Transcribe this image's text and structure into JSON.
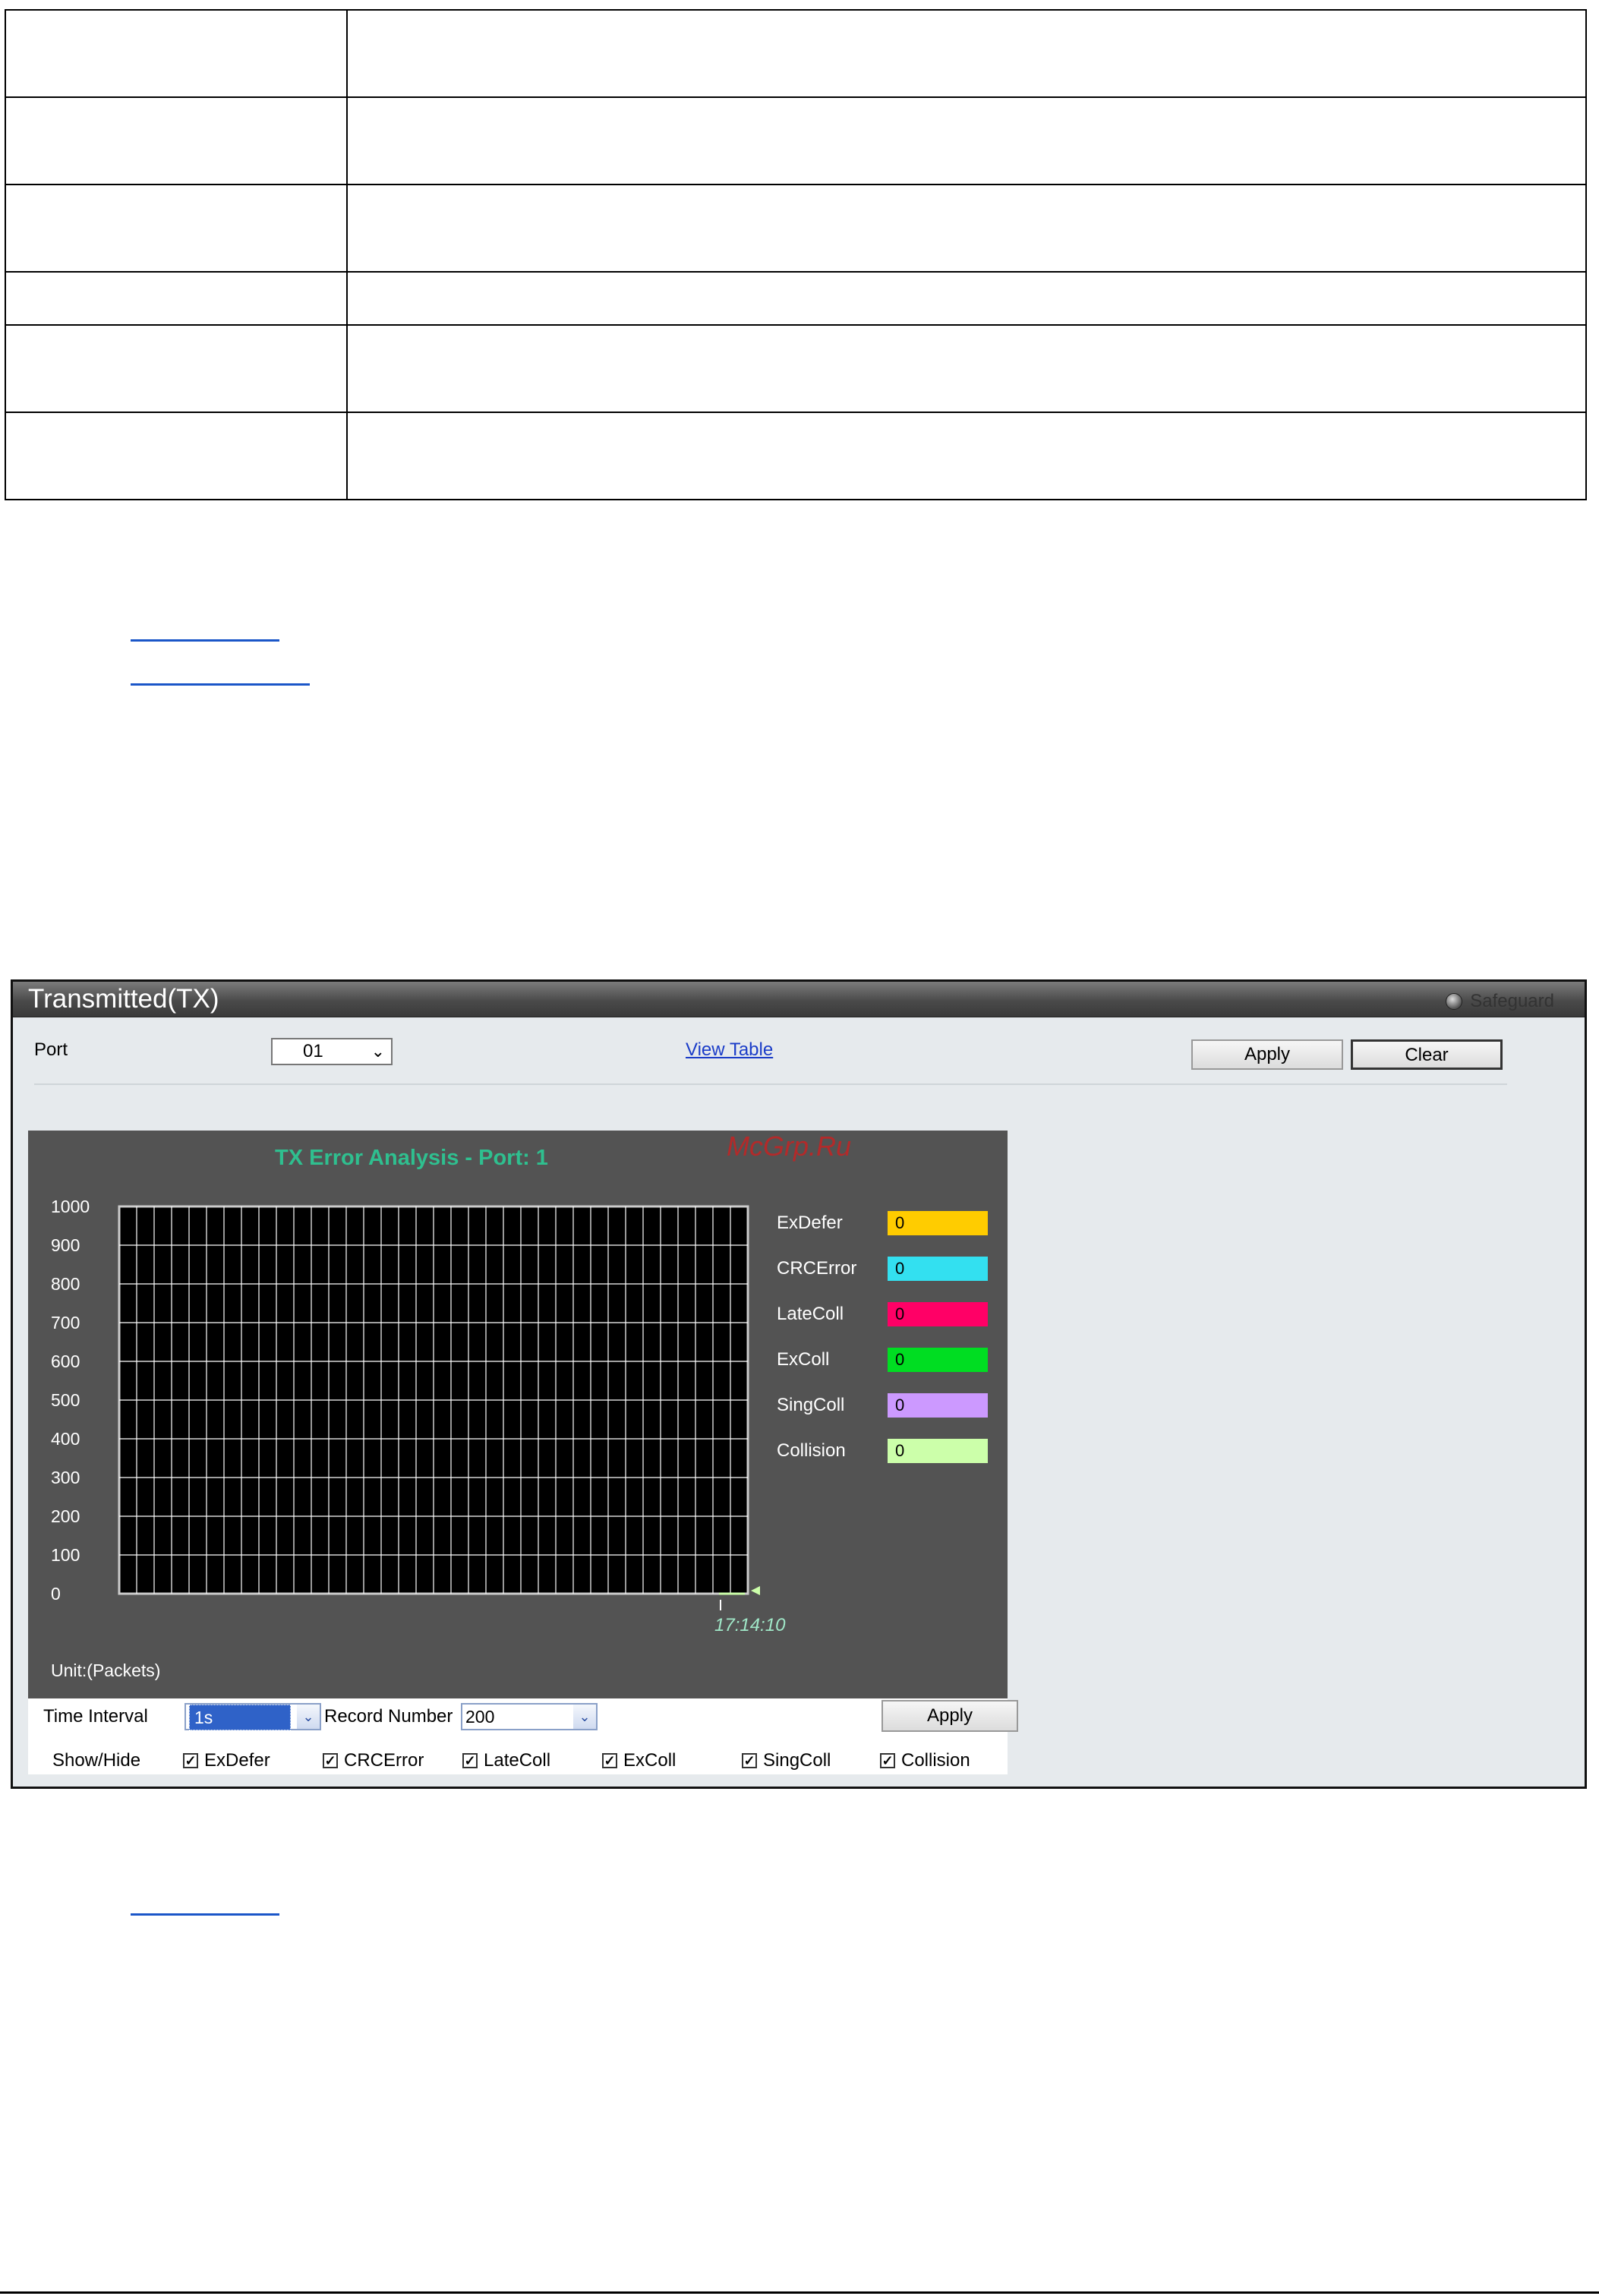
{
  "panel": {
    "title": "Transmitted(TX)",
    "safeguard": "Safeguard",
    "port_label": "Port",
    "port_value": "01",
    "view_table": "View Table",
    "apply": "Apply",
    "clear": "Clear"
  },
  "chart_data": {
    "type": "line",
    "title": "TX Error Analysis - Port: 1",
    "ylabel": "",
    "xlabel": "",
    "ylim": [
      0,
      1000
    ],
    "yticks": [
      "1000",
      "900",
      "800",
      "700",
      "600",
      "500",
      "400",
      "300",
      "200",
      "100",
      "0"
    ],
    "x": [
      "17:14:10"
    ],
    "grid": true,
    "background": "#000000",
    "series": [
      {
        "name": "ExDefer",
        "values": [
          0
        ],
        "color": "#ffcc00"
      },
      {
        "name": "CRCError",
        "values": [
          0
        ],
        "color": "#33e0f0"
      },
      {
        "name": "LateColl",
        "values": [
          0
        ],
        "color": "#ff0066"
      },
      {
        "name": "ExColl",
        "values": [
          0
        ],
        "color": "#00dd22"
      },
      {
        "name": "SingColl",
        "values": [
          0
        ],
        "color": "#cc99ff"
      },
      {
        "name": "Collision",
        "values": [
          0
        ],
        "color": "#ccffaa"
      }
    ],
    "unit": "Unit:(Packets)",
    "watermark": "McGrp.Ru"
  },
  "legend": [
    {
      "label": "ExDefer",
      "value": "0",
      "color": "#ffcc00"
    },
    {
      "label": "CRCError",
      "value": "0",
      "color": "#33e0f0"
    },
    {
      "label": "LateColl",
      "value": "0",
      "color": "#ff0066"
    },
    {
      "label": "ExColl",
      "value": "0",
      "color": "#00dd22"
    },
    {
      "label": "SingColl",
      "value": "0",
      "color": "#cc99ff"
    },
    {
      "label": "Collision",
      "value": "0",
      "color": "#ccffaa"
    }
  ],
  "controls": {
    "time_interval_label": "Time Interval",
    "time_interval_value": "1s",
    "record_number_label": "Record Number",
    "record_number_value": "200",
    "apply": "Apply",
    "show_hide_label": "Show/Hide",
    "checks": [
      "ExDefer",
      "CRCError",
      "LateColl",
      "ExColl",
      "SingColl",
      "Collision"
    ]
  }
}
